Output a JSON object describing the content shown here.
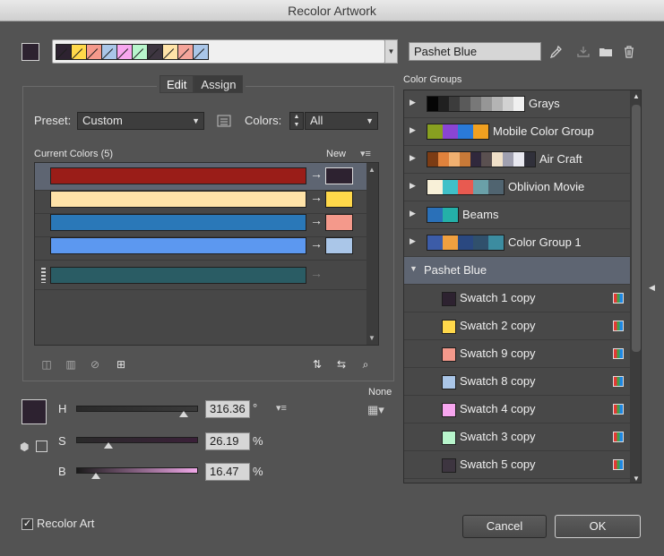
{
  "window": {
    "title": "Recolor Artwork"
  },
  "harmony": {
    "current_swatch_color": "#2d2230",
    "colors": [
      "#2d2230",
      "#ffd84a",
      "#f4998b",
      "#aac6e8",
      "#f7a6ef",
      "#b8f5cc",
      "#3d3540",
      "#ffe3a8",
      "#f4a49a",
      "#aac6e8"
    ],
    "name": "Pashet Blue",
    "icons": [
      "eyedropper-icon",
      "save-group-icon",
      "folder-icon",
      "trash-icon"
    ]
  },
  "tabs": [
    {
      "label": "Edit"
    },
    {
      "label": "Assign"
    }
  ],
  "preset": {
    "label": "Preset:",
    "value": "Custom"
  },
  "colors_control": {
    "label": "Colors:",
    "value": "All"
  },
  "current_colors": {
    "header": "Current Colors (5)",
    "new_header": "New",
    "rows": [
      {
        "current": "#9a1d18",
        "new": "#2d2230",
        "selected": true
      },
      {
        "current": "#ffe3a8",
        "new": "#ffd84a",
        "selected": false
      },
      {
        "current": "#2a78b8",
        "new": "#f4998b",
        "selected": false
      },
      {
        "current": "#5c98f0",
        "new": "#aac6e8",
        "selected": false
      },
      {
        "current": "#2a5c64",
        "new": null,
        "selected": false
      }
    ]
  },
  "hsb": {
    "preview_color": "#2d2230",
    "h": {
      "label": "H",
      "value": "316.36",
      "unit": "°",
      "fraction": 0.879
    },
    "s": {
      "label": "S",
      "value": "26.19",
      "unit": "%",
      "fraction": 0.262
    },
    "b": {
      "label": "B",
      "value": "16.47",
      "unit": "%",
      "fraction": 0.165
    },
    "none_label": "None"
  },
  "color_groups": {
    "header": "Color Groups",
    "groups": [
      {
        "name": "Grays",
        "colors": [
          "#050505",
          "#202020",
          "#3c3c3c",
          "#5a5a5a",
          "#787878",
          "#969696",
          "#b4b4b4",
          "#d2d2d2",
          "#f0f0f0"
        ]
      },
      {
        "name": "Mobile Color Group",
        "colors": [
          "#88a020",
          "#8a45d4",
          "#2a7ad8",
          "#f0a020"
        ]
      },
      {
        "name": "Air Craft",
        "colors": [
          "#7c3c14",
          "#e0823c",
          "#f0b070",
          "#c87a38",
          "#30283c",
          "#5a5050",
          "#f0e0c8",
          "#a0a0b0",
          "#e8e8f0",
          "#30303a"
        ]
      },
      {
        "name": "Oblivion Movie",
        "colors": [
          "#f8f0d8",
          "#40c0c8",
          "#e85a50",
          "#6aa0a8",
          "#506470"
        ]
      },
      {
        "name": "Beams",
        "colors": [
          "#2a70b8",
          "#24b0a8"
        ]
      },
      {
        "name": "Color Group 1",
        "colors": [
          "#3c5ca8",
          "#f0a040",
          "#2a4880",
          "#30506c",
          "#3c8ca0"
        ]
      }
    ],
    "open_group": {
      "name": "Pashet Blue",
      "swatches": [
        {
          "name": "Swatch 1 copy",
          "color": "#2d2230"
        },
        {
          "name": "Swatch 2 copy",
          "color": "#ffd84a"
        },
        {
          "name": "Swatch 9 copy",
          "color": "#f4998b"
        },
        {
          "name": "Swatch 8 copy",
          "color": "#aac6e8"
        },
        {
          "name": "Swatch 4 copy",
          "color": "#f7a6ef"
        },
        {
          "name": "Swatch 3 copy",
          "color": "#b8f5cc"
        },
        {
          "name": "Swatch 5 copy",
          "color": "#3d3540"
        }
      ]
    }
  },
  "recolor_art": {
    "label": "Recolor Art",
    "checked": true
  },
  "buttons": {
    "cancel": "Cancel",
    "ok": "OK"
  }
}
